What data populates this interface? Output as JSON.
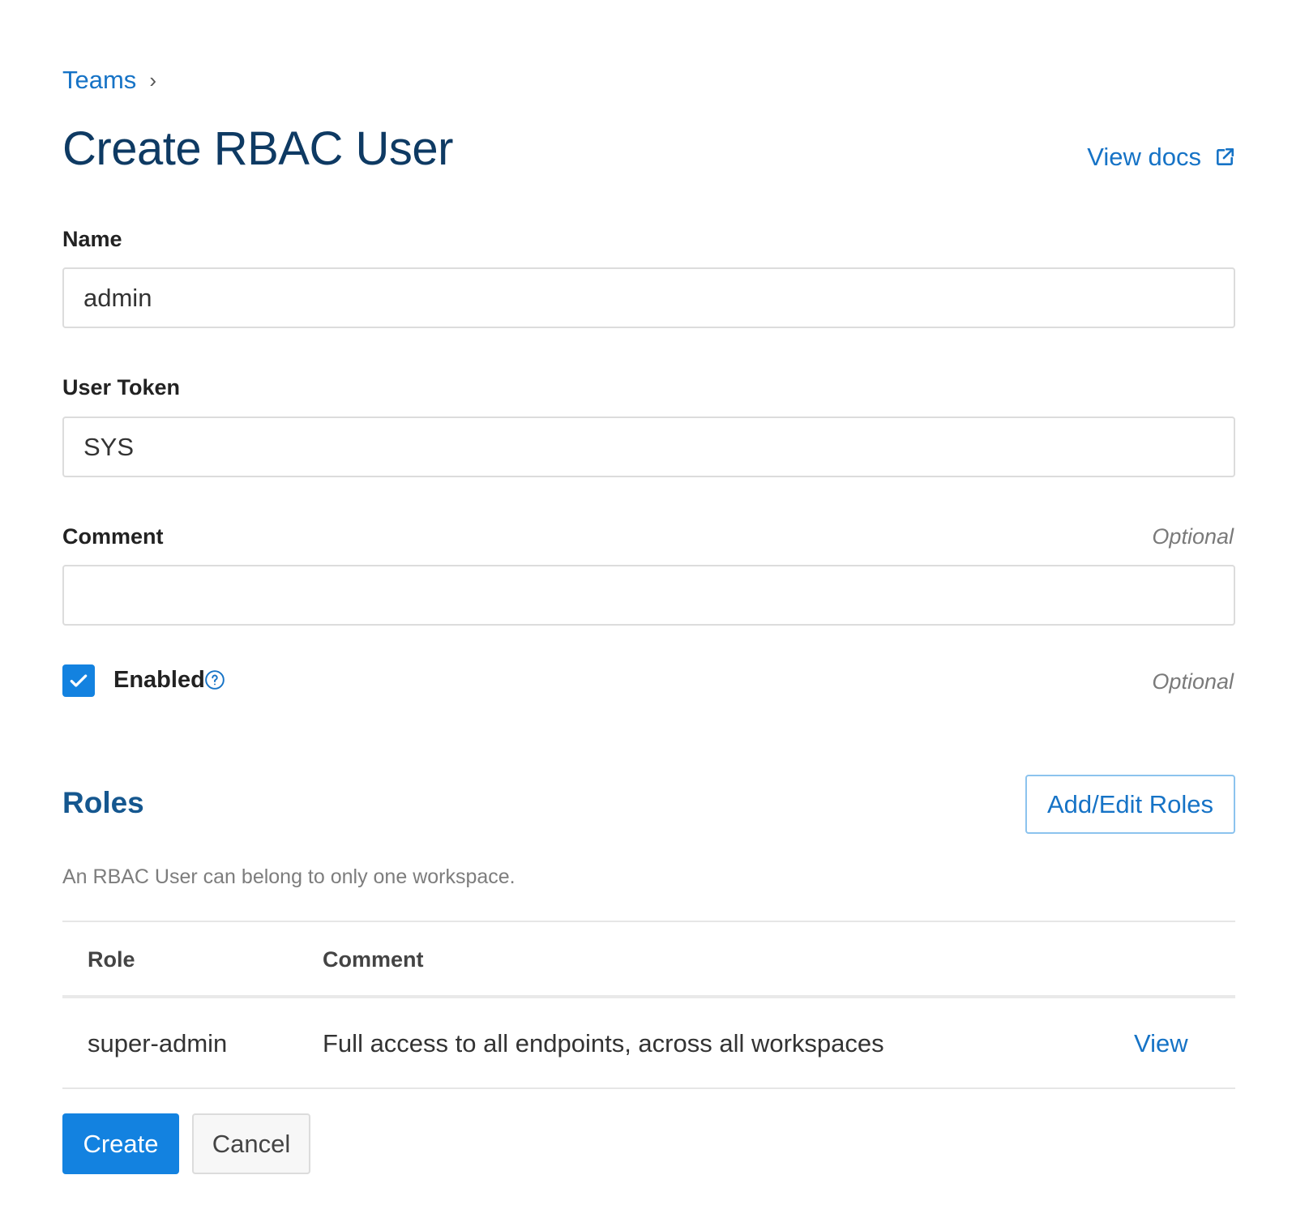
{
  "breadcrumb": {
    "parent": "Teams",
    "separator": "›"
  },
  "page": {
    "title": "Create RBAC User",
    "docs_link": "View docs"
  },
  "form": {
    "name": {
      "label": "Name",
      "value": "admin"
    },
    "token": {
      "label": "User Token",
      "value": "SYS"
    },
    "comment": {
      "label": "Comment",
      "value": "",
      "optional": "Optional"
    },
    "enabled": {
      "label": "Enabled",
      "checked": true,
      "optional": "Optional"
    }
  },
  "roles": {
    "title": "Roles",
    "add_button": "Add/Edit Roles",
    "hint": "An RBAC User can belong to only one workspace.",
    "columns": {
      "role": "Role",
      "comment": "Comment"
    },
    "rows": [
      {
        "role": "super-admin",
        "comment": "Full access to all endpoints, across all workspaces",
        "action": "View"
      }
    ]
  },
  "actions": {
    "create": "Create",
    "cancel": "Cancel"
  },
  "colors": {
    "accent": "#1382e0",
    "link": "#1673c6",
    "title": "#0e3a63",
    "section": "#15578f"
  }
}
